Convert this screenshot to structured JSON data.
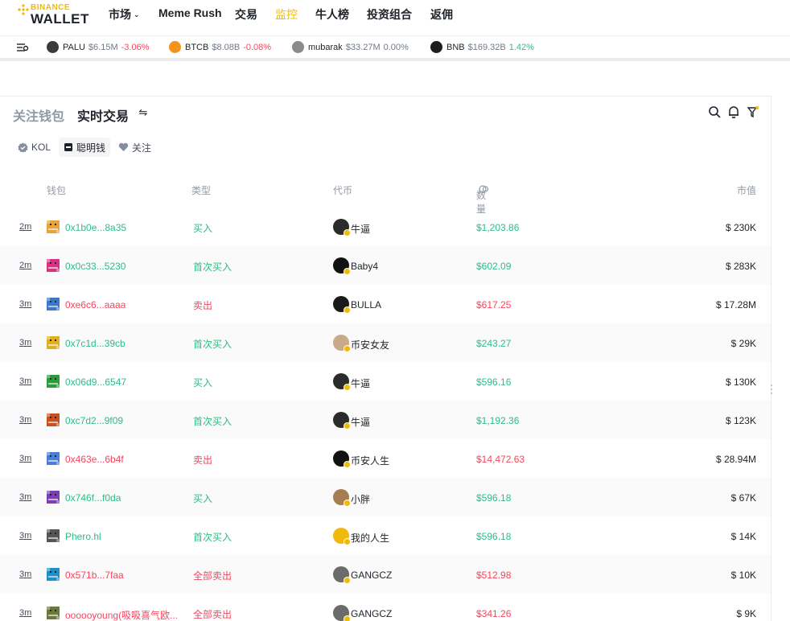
{
  "nav": {
    "brand_top": "BINANCE",
    "brand_bottom": "WALLET",
    "items": [
      {
        "label": "市场",
        "dropdown": true
      },
      {
        "label": "Meme Rush"
      },
      {
        "label": "交易"
      },
      {
        "label": "监控",
        "active": true
      },
      {
        "label": "牛人榜"
      },
      {
        "label": "投资组合"
      },
      {
        "label": "返佣"
      }
    ]
  },
  "ticker": [
    {
      "symbol": "PALU",
      "cap": "$6.15M",
      "change": "-3.06%",
      "dir": "neg",
      "color": "#3b3b3b"
    },
    {
      "symbol": "BTCB",
      "cap": "$8.08B",
      "change": "-0.08%",
      "dir": "neg",
      "color": "#f7931a"
    },
    {
      "symbol": "mubarak",
      "cap": "$33.27M",
      "change": "0.00%",
      "dir": "zero",
      "color": "#8a8a8a"
    },
    {
      "symbol": "BNB",
      "cap": "$169.32B",
      "change": "1.42%",
      "dir": "pos",
      "color": "#1e1e1e"
    }
  ],
  "section": {
    "tab_follow": "关注钱包",
    "tab_live": "实时交易",
    "swap_icon": "⇋"
  },
  "filters": [
    {
      "label": "KOL",
      "icon": "verified-icon",
      "active": false
    },
    {
      "label": "聪明钱",
      "icon": "wallet-icon",
      "active": true
    },
    {
      "label": "关注",
      "icon": "heart-icon",
      "active": false
    }
  ],
  "table": {
    "headers": {
      "wallet": "钱包",
      "type": "类型",
      "token": "代币",
      "amount": "数量",
      "mcap": "市值"
    },
    "rows": [
      {
        "age": "2m",
        "addr": "0x1b0e...8a35",
        "type": "买入",
        "side": "buy",
        "token": "牛逼",
        "amount": "$1,203.86",
        "mcap": "$ 230K",
        "avatar": "#e8a33a",
        "tokcolor": "#2b2b2b"
      },
      {
        "age": "2m",
        "addr": "0x0c33...5230",
        "type": "首次买入",
        "side": "buy",
        "token": "Baby4",
        "amount": "$602.09",
        "mcap": "$ 283K",
        "avatar": "#d63384",
        "tokcolor": "#111111"
      },
      {
        "age": "3m",
        "addr": "0xe6c6...aaaa",
        "type": "卖出",
        "side": "sell",
        "token": "BULLA",
        "amount": "$617.25",
        "mcap": "$ 17.28M",
        "avatar": "#3a78c9",
        "tokcolor": "#1a1a1a"
      },
      {
        "age": "3m",
        "addr": "0x7c1d...39cb",
        "type": "首次买入",
        "side": "buy",
        "token": "币安女友",
        "amount": "$243.27",
        "mcap": "$ 29K",
        "avatar": "#e0b020",
        "tokcolor": "#c9a98a"
      },
      {
        "age": "3m",
        "addr": "0x06d9...6547",
        "type": "买入",
        "side": "buy",
        "token": "牛逼",
        "amount": "$596.16",
        "mcap": "$ 130K",
        "avatar": "#2a9d3a",
        "tokcolor": "#2b2b2b"
      },
      {
        "age": "3m",
        "addr": "0xc7d2...9f09",
        "type": "首次买入",
        "side": "buy",
        "token": "牛逼",
        "amount": "$1,192.36",
        "mcap": "$ 123K",
        "avatar": "#c8501e",
        "tokcolor": "#2b2b2b"
      },
      {
        "age": "3m",
        "addr": "0x463e...6b4f",
        "type": "卖出",
        "side": "sell",
        "token": "币安人生",
        "amount": "$14,472.63",
        "mcap": "$ 28.94M",
        "avatar": "#4a7fd6",
        "tokcolor": "#111111"
      },
      {
        "age": "3m",
        "addr": "0x746f...f0da",
        "type": "买入",
        "side": "buy",
        "token": "小胖",
        "amount": "$596.18",
        "mcap": "$ 67K",
        "avatar": "#7a3fb5",
        "tokcolor": "#a67c52"
      },
      {
        "age": "3m",
        "addr": "Phero.hl",
        "type": "首次买入",
        "side": "buy",
        "token": "我的人生",
        "amount": "$596.18",
        "mcap": "$ 14K",
        "avatar": "#555555",
        "tokcolor": "#f0b90b"
      },
      {
        "age": "3m",
        "addr": "0x571b...7faa",
        "type": "全部卖出",
        "side": "sell",
        "token": "GANGCZ",
        "amount": "$512.98",
        "mcap": "$ 10K",
        "avatar": "#1e90c8",
        "tokcolor": "#6b6b6b"
      },
      {
        "age": "3m",
        "addr": "oooooyoung(吸吸喜气欧...",
        "type": "全部卖出",
        "side": "sell",
        "token": "GANGCZ",
        "amount": "$341.26",
        "mcap": "$ 9K",
        "avatar": "#6b7a3a",
        "tokcolor": "#6b6b6b"
      }
    ]
  }
}
